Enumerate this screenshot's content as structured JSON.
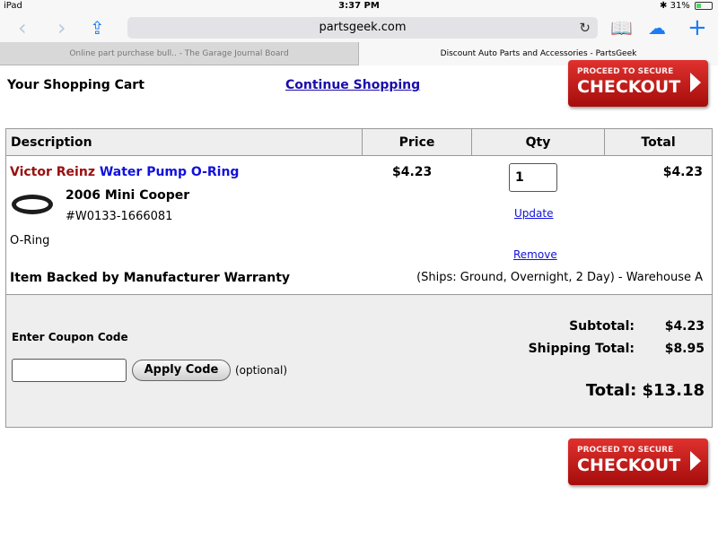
{
  "status": {
    "device": "iPad",
    "time": "3:37 PM",
    "battery": "31%",
    "battery_level": 0.31
  },
  "browser": {
    "url": "partsgeek.com",
    "tabs": [
      {
        "label": "Online part purchase bull.. - The Garage Journal Board"
      },
      {
        "label": "Discount Auto Parts and Accessories - PartsGeek"
      }
    ]
  },
  "cart": {
    "title": "Your Shopping Cart",
    "continue_link": "Continue Shopping",
    "checkout": {
      "small": "PROCEED TO SECURE",
      "big": "CHECKOUT"
    },
    "headers": {
      "description": "Description",
      "price": "Price",
      "qty": "Qty",
      "total": "Total"
    },
    "item": {
      "brand": "Victor Reinz",
      "name": "Water Pump O-Ring",
      "vehicle": "2006 Mini Cooper",
      "part_number": "#W0133-1666081",
      "type": "O-Ring",
      "price": "$4.23",
      "qty": "1",
      "total": "$4.23",
      "update": "Update",
      "remove": "Remove",
      "warranty": "Item Backed by Manufacturer Warranty",
      "shipping_info": "(Ships: Ground, Overnight, 2 Day) - Warehouse A"
    },
    "coupon": {
      "label": "Enter Coupon Code",
      "value": "",
      "button": "Apply Code",
      "optional": "(optional)"
    },
    "summary": {
      "subtotal_label": "Subtotal:",
      "subtotal": "$4.23",
      "shipping_label": "Shipping Total:",
      "shipping": "$8.95",
      "total": "Total: $13.18"
    }
  }
}
